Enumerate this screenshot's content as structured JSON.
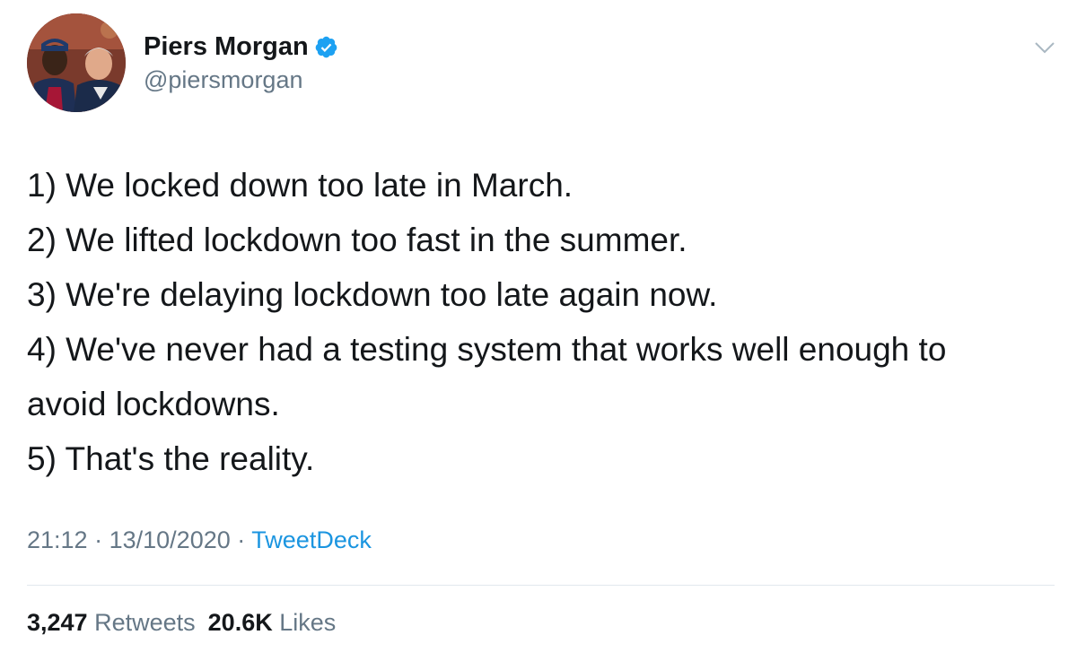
{
  "author": {
    "display_name": "Piers Morgan",
    "handle": "@piersmorgan",
    "verified": true
  },
  "icons": {
    "verified": "verified-badge-icon",
    "menu": "chevron-down-icon"
  },
  "tweet": {
    "lines": [
      "1) We locked down too late in March.",
      "2) We lifted lockdown too fast in the summer.",
      "3) We're delaying lockdown too late again now.",
      "4) We've never had a testing system that works well enough to",
      "avoid lockdowns.",
      "5) That's the reality."
    ]
  },
  "meta": {
    "time": "21:12",
    "separator": "·",
    "date": "13/10/2020",
    "source": "TweetDeck"
  },
  "stats": {
    "retweets_count": "3,247",
    "retweets_label": "Retweets",
    "likes_count": "20.6K",
    "likes_label": "Likes"
  },
  "colors": {
    "text": "#14171a",
    "secondary": "#657786",
    "link": "#1b95e0",
    "verified": "#1da1f2",
    "divider": "#e1e8ed"
  }
}
